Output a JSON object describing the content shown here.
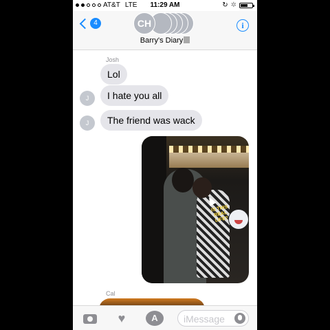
{
  "status_bar": {
    "carrier": "AT&T",
    "network": "LTE",
    "time": "11:29 AM"
  },
  "nav": {
    "back_badge": "4",
    "avatar_initials": "CH",
    "group_name": "Barry's Diary",
    "info_glyph": "i"
  },
  "messages": [
    {
      "sender": "Josh",
      "text": "Lol",
      "avatar": "J"
    },
    {
      "text": "I hate you all",
      "avatar": "J"
    },
    {
      "text": "The friend was wack",
      "avatar": "J"
    }
  ],
  "photo": {
    "sticker_text": "IS THIS REAL LIFE?"
  },
  "next_sender": "Cal",
  "input": {
    "placeholder": "iMessage",
    "appstore_glyph": "A"
  },
  "colors": {
    "accent": "#1a8cff",
    "bubble_gray": "#e5e5ea"
  }
}
